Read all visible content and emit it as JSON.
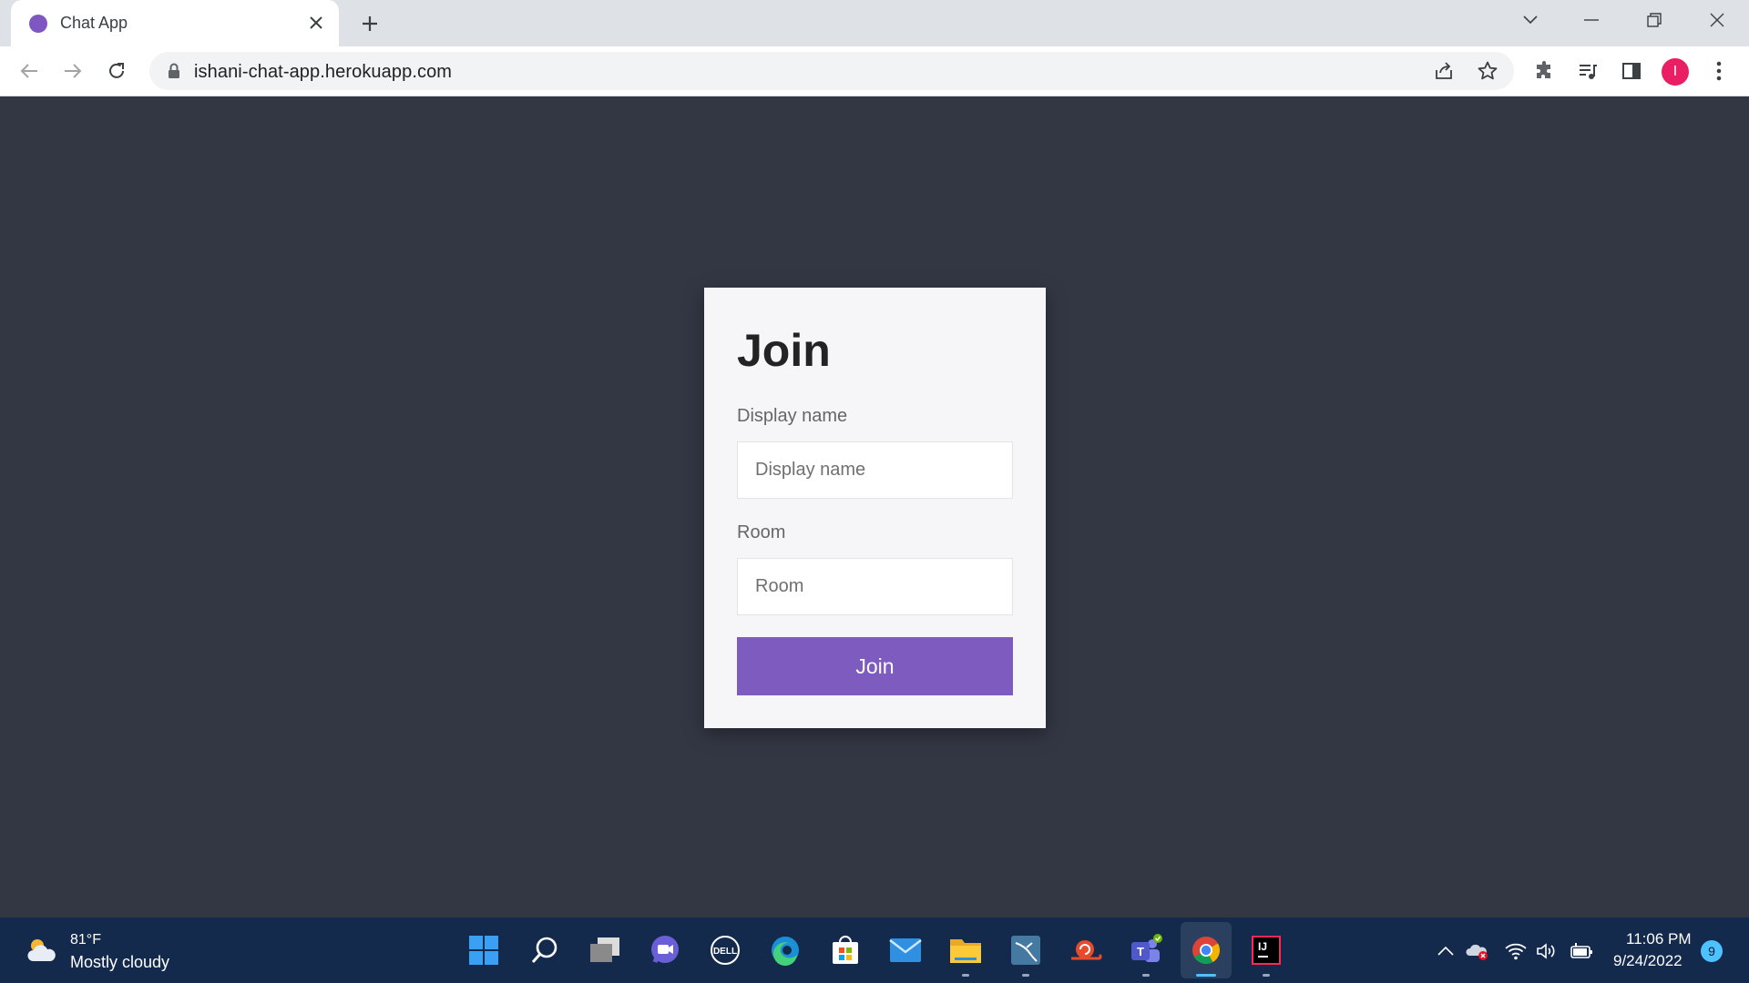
{
  "browser": {
    "tab_title": "Chat App",
    "url": "ishani-chat-app.herokuapp.com",
    "profile_initial": "I"
  },
  "form": {
    "title": "Join",
    "display_name_label": "Display name",
    "display_name_placeholder": "Display name",
    "display_name_value": "",
    "room_label": "Room",
    "room_placeholder": "Room",
    "room_value": "",
    "submit_label": "Join"
  },
  "taskbar": {
    "weather_temp": "81°F",
    "weather_desc": "Mostly cloudy",
    "time": "11:06 PM",
    "date": "9/24/2022",
    "notification_count": "9"
  },
  "icons": {
    "tab": [
      "favicon",
      "close-icon",
      "new-tab-icon"
    ],
    "window": [
      "tab-search-icon",
      "minimize-icon",
      "restore-icon",
      "window-close-icon"
    ],
    "toolbar": [
      "back-icon",
      "forward-icon",
      "reload-icon",
      "lock-icon",
      "share-icon",
      "star-icon",
      "extensions-icon",
      "media-icon",
      "side-panel-icon",
      "menu-icon"
    ],
    "taskbar": [
      "weather-icon",
      "start-icon",
      "search-icon",
      "task-view-icon",
      "chat-icon",
      "dell-icon",
      "edge-icon",
      "store-icon",
      "mail-icon",
      "file-explorer-icon",
      "mysql-icon",
      "snail-app-icon",
      "teams-icon",
      "chrome-icon",
      "intellij-icon"
    ],
    "tray": [
      "chevron-up-icon",
      "onedrive-icon",
      "wifi-icon",
      "volume-icon",
      "battery-icon"
    ]
  },
  "colors": {
    "page_background": "#333744",
    "card_background": "#f6f6f9",
    "accent": "#7e5bbe",
    "taskbar": "#142a4d",
    "profile": "#e91e63"
  }
}
